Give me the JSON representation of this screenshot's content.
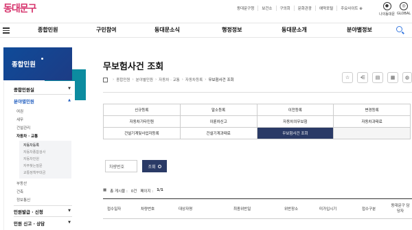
{
  "logo": "동대문구",
  "util_links": [
    "동대문구청",
    "보건소",
    "구의회",
    "문화관광",
    "예약포털",
    "주요사이트 ⊕"
  ],
  "user_menu": {
    "mypage": "나의동대문",
    "global": "GLOBAL"
  },
  "gnb": [
    "종합민원",
    "구민참여",
    "동대문소식",
    "행정정보",
    "동대문소개",
    "분야별정보"
  ],
  "lnb": {
    "title": "종합민원",
    "items": [
      {
        "label": "종합민원실"
      },
      {
        "label": "분야별민원"
      },
      {
        "label": "여권"
      },
      {
        "label": "세무"
      },
      {
        "label": "건설관리"
      },
      {
        "label": "자동차 · 교통"
      },
      {
        "label": "자동차등록"
      },
      {
        "label": "자동차종합검사"
      },
      {
        "label": "자동차민원"
      },
      {
        "label": "자주찾는질문"
      },
      {
        "label": "교통정책부대금"
      },
      {
        "label": "부동산"
      },
      {
        "label": "건축"
      },
      {
        "label": "정보통신"
      },
      {
        "label": "민원발급 · 신청"
      },
      {
        "label": "민원 신고 · 상담"
      }
    ]
  },
  "page": {
    "title": "무보험사건 조회",
    "breadcrumb": [
      "종합민원",
      "분야별민원",
      "자동차 · 교통",
      "자동차등록",
      "무보험사건 조회"
    ]
  },
  "tabs": [
    "신규등록",
    "말소등록",
    "이전등록",
    "변경등록",
    "자동차기타민원",
    "이륜차신고",
    "자동차의무보험",
    "자동차과태료",
    "건설기계및사업자등록",
    "건설기계과태료",
    "무보험사건 조회",
    ""
  ],
  "search": {
    "field_label": "차량번호",
    "button": "조회"
  },
  "count": {
    "total_label": "총 게시물 :",
    "total": "0건",
    "page_label": "페이지 :",
    "page": "1/1"
  },
  "table_headers": [
    "접수일자",
    "차량번호",
    "대상자명",
    "최종위반일",
    "위반장소",
    "미가입시기",
    "접수구분",
    "동대문구 담당자"
  ]
}
